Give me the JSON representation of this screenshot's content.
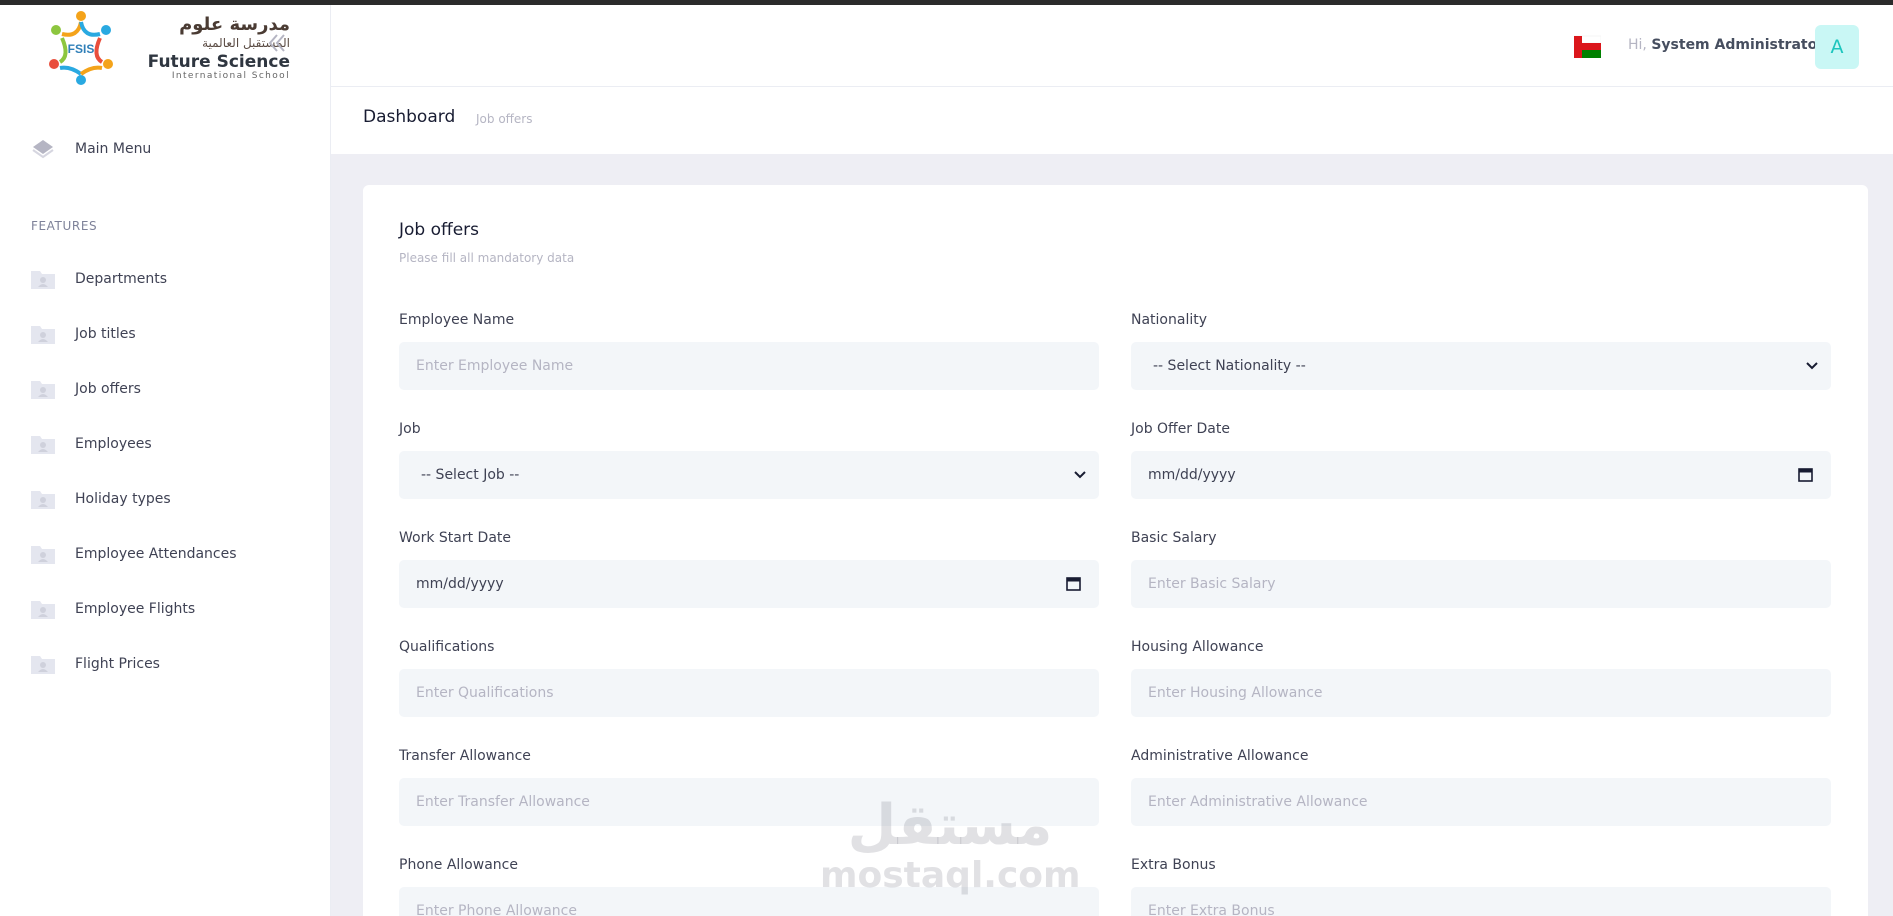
{
  "brand": {
    "monogram": "FSIS",
    "arabic_line1": "مدرسة علوم",
    "arabic_line2": "المستقبل العالمية",
    "english_line1": "Future Science",
    "english_line2": "International School"
  },
  "sidebar": {
    "main_menu": "Main Menu",
    "section_title": "FEATURES",
    "items": [
      {
        "label": "Departments"
      },
      {
        "label": "Job titles"
      },
      {
        "label": "Job offers"
      },
      {
        "label": "Employees"
      },
      {
        "label": "Holiday types"
      },
      {
        "label": "Employee Attendances"
      },
      {
        "label": "Employee Flights"
      },
      {
        "label": "Flight Prices"
      }
    ]
  },
  "header": {
    "greeting": "Hi,",
    "user_name": "System Administrator",
    "avatar_letter": "A"
  },
  "breadcrumb": {
    "title": "Dashboard",
    "current": "Job offers"
  },
  "form": {
    "title": "Job offers",
    "subtitle": "Please fill all mandatory data",
    "employee_name": {
      "label": "Employee Name",
      "placeholder": "Enter Employee Name"
    },
    "nationality": {
      "label": "Nationality",
      "value": "-- Select Nationality --"
    },
    "job": {
      "label": "Job",
      "value": "-- Select Job --"
    },
    "job_offer_date": {
      "label": "Job Offer Date",
      "value": "mm/dd/yyyy"
    },
    "work_start_date": {
      "label": "Work Start Date",
      "value": "mm/dd/yyyy"
    },
    "basic_salary": {
      "label": "Basic Salary",
      "placeholder": "Enter Basic Salary"
    },
    "qualifications": {
      "label": "Qualifications",
      "placeholder": "Enter Qualifications"
    },
    "housing_allowance": {
      "label": "Housing Allowance",
      "placeholder": "Enter Housing Allowance"
    },
    "transfer_allowance": {
      "label": "Transfer Allowance",
      "placeholder": "Enter Transfer Allowance"
    },
    "administrative_allowance": {
      "label": "Administrative Allowance",
      "placeholder": "Enter Administrative Allowance"
    },
    "phone_allowance": {
      "label": "Phone Allowance",
      "placeholder": "Enter Phone Allowance"
    },
    "extra_bonus": {
      "label": "Extra Bonus",
      "placeholder": "Enter Extra Bonus"
    }
  },
  "watermark": {
    "arabic": "مستقل",
    "english": "mostaql.com"
  }
}
